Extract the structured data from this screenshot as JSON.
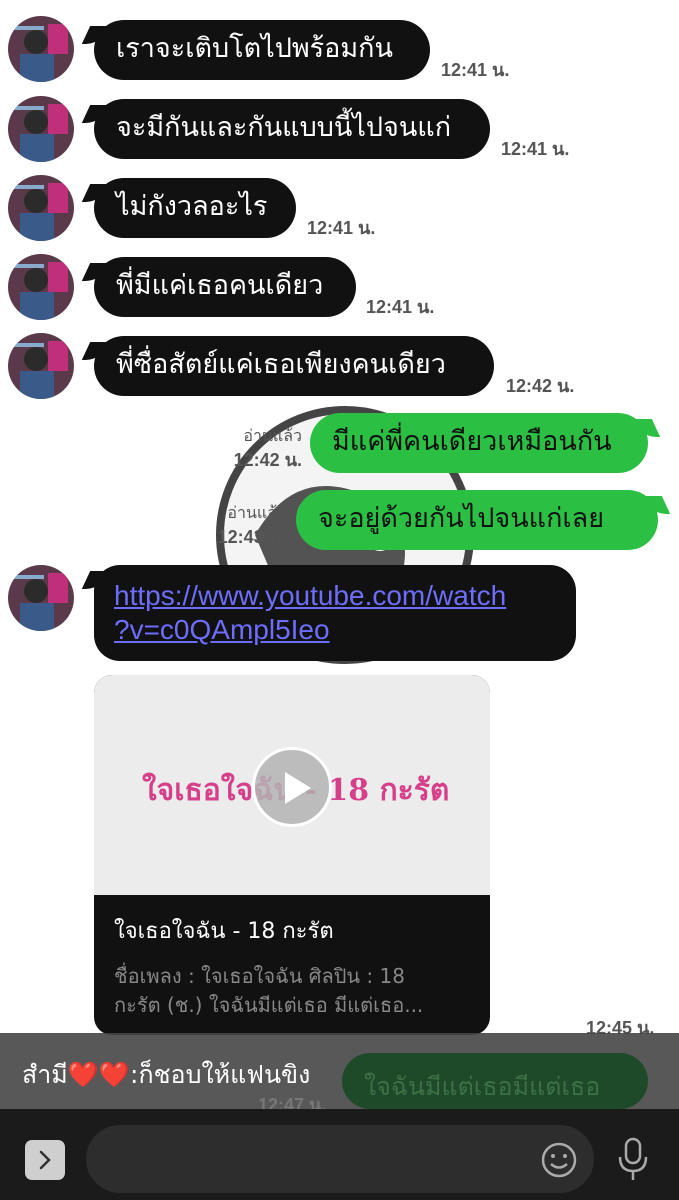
{
  "messages": [
    {
      "text": "เราจะเติบโตไปพร้อมกัน",
      "time": "12:41 น."
    },
    {
      "text": "จะมีกันและกันแบบนี้ไปจนแก่",
      "time": "12:41 น."
    },
    {
      "text": "ไม่กังวลอะไร",
      "time": "12:41 น."
    },
    {
      "text": "พี่มีแค่เธอคนเดียว",
      "time": "12:41 น."
    },
    {
      "text": "พี่ซื่อสัตย์แค่เธอเพียงคนเดียว",
      "time": "12:42 น."
    }
  ],
  "outgoing": [
    {
      "text": "มีแค่พี่คนเดียวเหมือนกัน",
      "read": "อ่านแล้ว",
      "time": "12:42 น."
    },
    {
      "text": "จะอยู่ด้วยกันไปจนแก่เลย",
      "read": "อ่านแล้ว",
      "time": "12:43 น."
    }
  ],
  "link": {
    "line1": "https://www.youtube.com/watch",
    "line2": "?v=c0QAmpl5Ieo"
  },
  "card": {
    "thumb_text": "ใจเธอใจฉัน - 18 กะรัต",
    "title": "ใจเธอใจฉัน - 18 กะรัต",
    "desc_line1": "ชื่อเพลง : ใจเธอใจฉัน ศิลปิน : 18",
    "desc_line2": "กะรัต (ช.) ใจฉันมีแต่เธอ มีแต่เธอ...",
    "time": "12:45 น."
  },
  "notification": {
    "sender": "สำมี❤️❤️",
    "text": "สำมี❤️❤️:ก็ชอบให้แฟนขิง",
    "ghost_text": "ใจฉันมีแต่เธอมีแต่เธอ",
    "ghost_time": "12:47 น."
  },
  "icons": {
    "expand": "chevron-right-icon",
    "emoji": "smiley-icon",
    "mic": "microphone-icon",
    "play": "play-icon"
  },
  "colors": {
    "incoming_bubble": "#111111",
    "outgoing_bubble": "#2bc043",
    "link": "#6d6dff"
  }
}
